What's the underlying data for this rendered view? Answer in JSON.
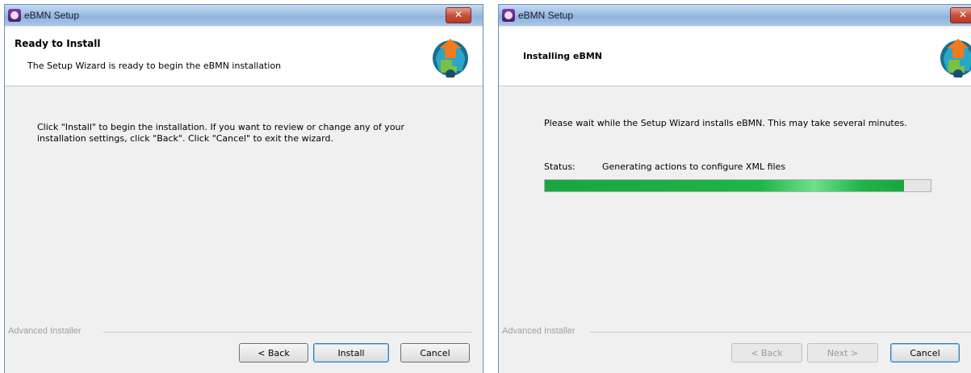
{
  "window_left": {
    "title": "eBMN Setup",
    "close_glyph": "✕",
    "heading": "Ready to Install",
    "subheading": "The Setup Wizard is ready to begin the eBMN installation",
    "body": "Click \"Install\" to begin the installation.  If you want to review or change any of your installation settings, click \"Back\".  Click \"Cancel\" to exit the wizard.",
    "brand": "Advanced Installer",
    "buttons": {
      "back": "< Back",
      "install": "Install",
      "cancel": "Cancel"
    }
  },
  "window_right": {
    "title": "eBMN Setup",
    "close_glyph": "✕",
    "heading": "Installing eBMN",
    "body": "Please wait while the Setup Wizard installs eBMN.  This may take several minutes.",
    "status_label": "Status:",
    "status_value": "Generating actions to configure XML files",
    "progress_fraction": 0.93,
    "brand": "Advanced Installer",
    "buttons": {
      "back": "< Back",
      "next": "Next >",
      "cancel": "Cancel"
    }
  },
  "colors": {
    "progress_green": "#1fb548",
    "close_red": "#c8503b",
    "titlebar_blue": "#9ebfe3"
  },
  "icons": [
    "app-icon",
    "close-icon",
    "installer-logo-icon"
  ]
}
